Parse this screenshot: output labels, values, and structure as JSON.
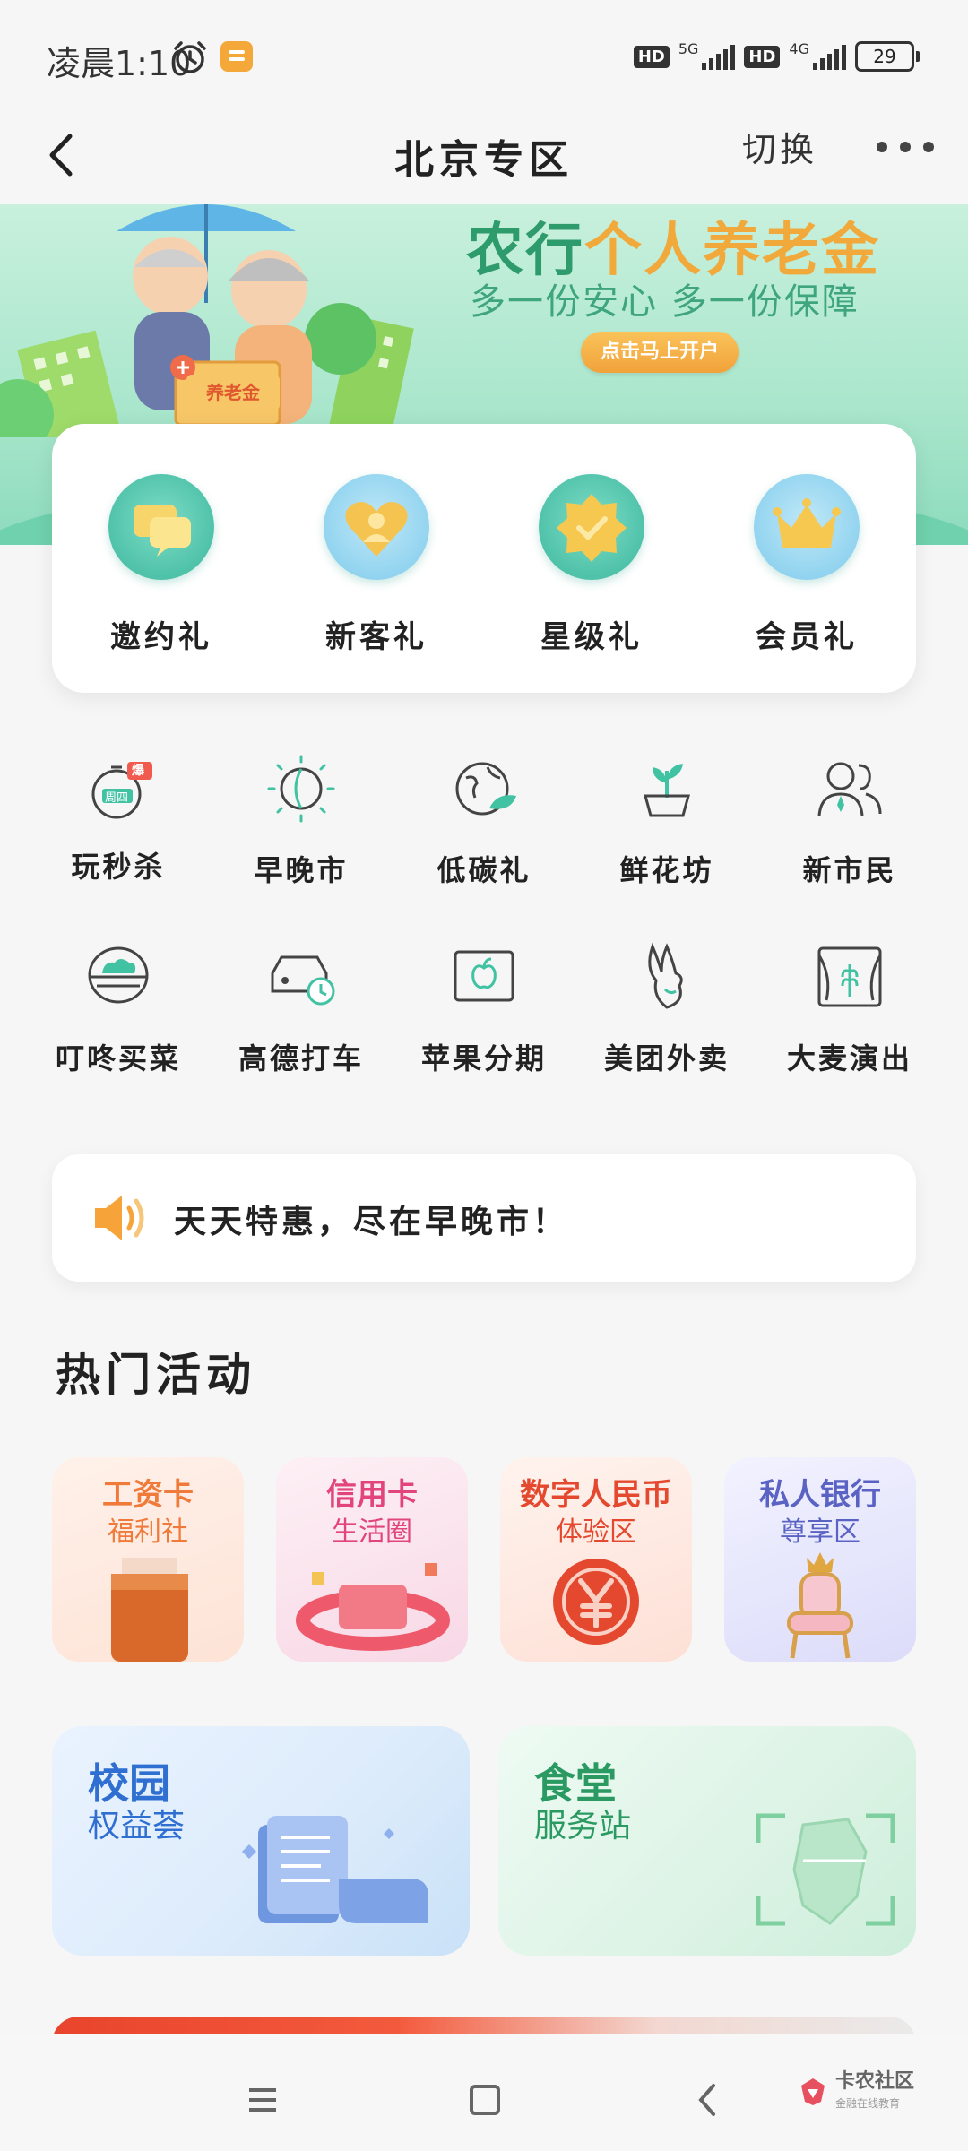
{
  "status_bar": {
    "time": "凌晨1:10",
    "hd1": "HD",
    "net1": "5G",
    "hd2": "HD",
    "net2": "4G",
    "battery": "29"
  },
  "nav": {
    "title": "北京专区",
    "switch_label": "切换"
  },
  "banner": {
    "title_a": "农行",
    "title_b": "个人养老金",
    "subtitle": "多一份安心 多一份保障",
    "cta": "点击马上开户",
    "badge": "养老金"
  },
  "gifts": [
    {
      "label": "邀约礼",
      "icon": "chat-bubbles-icon"
    },
    {
      "label": "新客礼",
      "icon": "heart-user-icon"
    },
    {
      "label": "星级礼",
      "icon": "star-badge-icon"
    },
    {
      "label": "会员礼",
      "icon": "crown-icon"
    }
  ],
  "services": [
    {
      "label": "玩秒杀",
      "icon": "stopwatch-icon",
      "badge": "爆",
      "sub": "周四"
    },
    {
      "label": "早晚市",
      "icon": "sun-moon-icon"
    },
    {
      "label": "低碳礼",
      "icon": "globe-leaf-icon"
    },
    {
      "label": "鲜花坊",
      "icon": "flower-pot-icon"
    },
    {
      "label": "新市民",
      "icon": "people-icon"
    },
    {
      "label": "叮咚买菜",
      "icon": "vegetable-bowl-icon"
    },
    {
      "label": "高德打车",
      "icon": "car-clock-icon"
    },
    {
      "label": "苹果分期",
      "icon": "apple-card-icon"
    },
    {
      "label": "美团外卖",
      "icon": "rabbit-icon"
    },
    {
      "label": "大麦演出",
      "icon": "stage-icon"
    }
  ],
  "notice": {
    "text": "天天特惠，尽在早晚市！",
    "icon": "speaker-icon"
  },
  "hot": {
    "title": "热门活动",
    "cards": [
      {
        "title": "工资卡",
        "sub": "福利社",
        "color": "#f07a3a"
      },
      {
        "title": "信用卡",
        "sub": "生活圈",
        "color": "#e2457c"
      },
      {
        "title": "数字人民币",
        "sub": "体验区",
        "color": "#e4492f"
      },
      {
        "title": "私人银行",
        "sub": "尊享区",
        "color": "#5a62c4"
      }
    ],
    "big_cards": [
      {
        "title": "校园",
        "sub": "权益荟",
        "color": "#2f6fd1"
      },
      {
        "title": "食堂",
        "sub": "服务站",
        "color": "#2a9a62"
      }
    ]
  },
  "watermark": {
    "text": "卡农社区",
    "sub": "金融在线教育"
  }
}
